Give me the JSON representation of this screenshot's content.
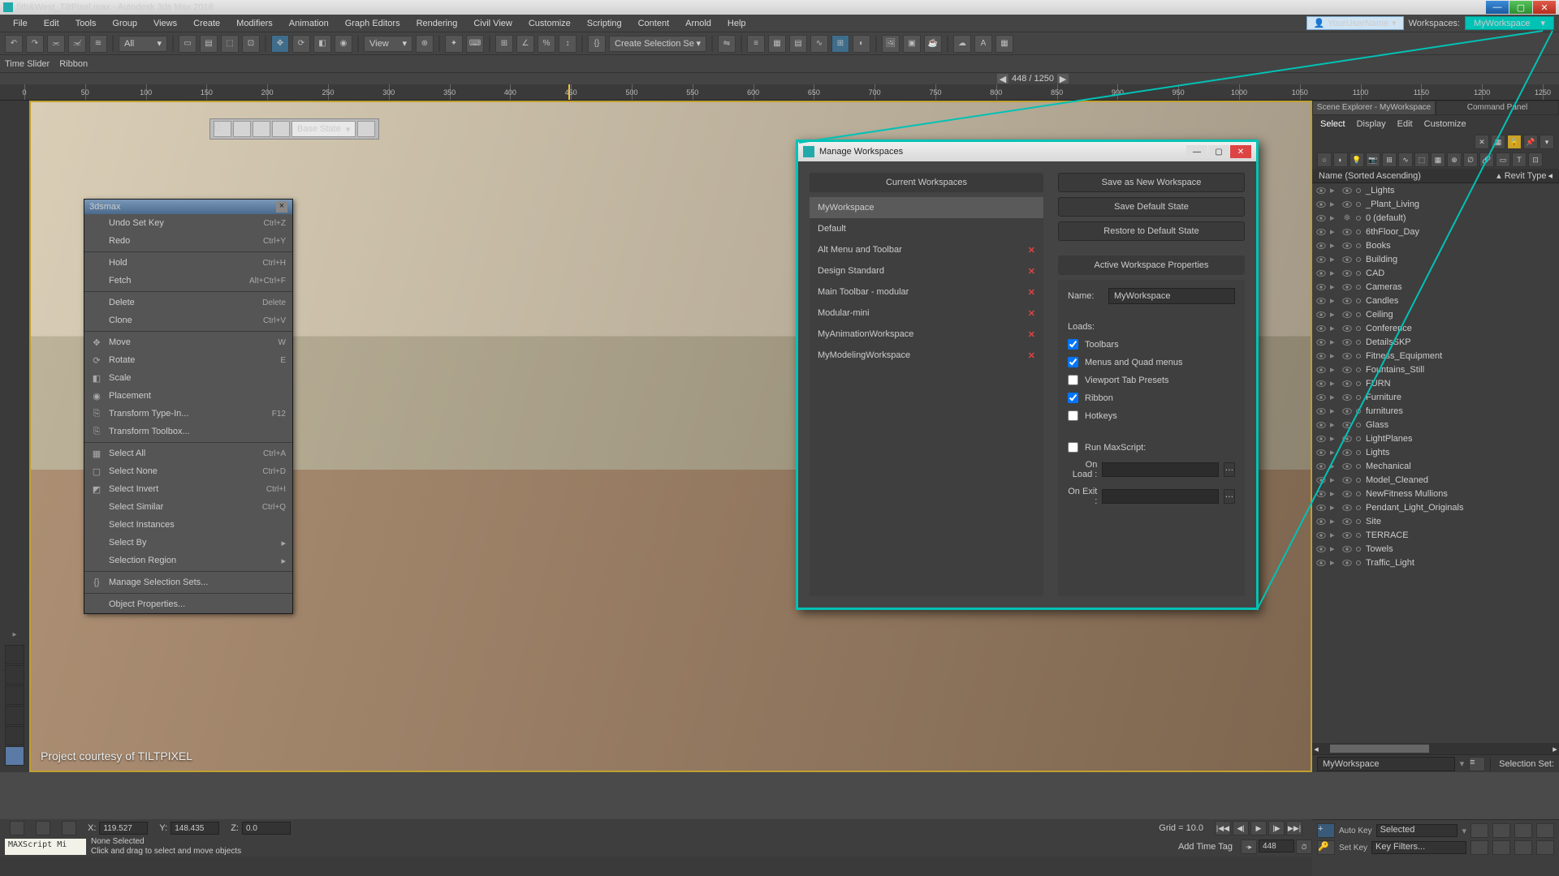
{
  "title": "5th&West_TiltPixel.max - Autodesk 3ds Max 2018",
  "menus": [
    "File",
    "Edit",
    "Tools",
    "Group",
    "Views",
    "Create",
    "Modifiers",
    "Animation",
    "Graph Editors",
    "Rendering",
    "Civil View",
    "Customize",
    "Scripting",
    "Content",
    "Arnold",
    "Help"
  ],
  "user_label": "YourUserName",
  "ws_label": "Workspaces:",
  "ws_current": "MyWorkspace",
  "toolbar_all": "All",
  "toolbar_view": "View",
  "toolbar_selset": "Create Selection Se",
  "ribbon_tabs": [
    "Time Slider",
    "Ribbon"
  ],
  "frame_display": "448 / 1250",
  "ruler_ticks": [
    0,
    50,
    100,
    150,
    200,
    250,
    300,
    350,
    400,
    450,
    500,
    550,
    600,
    650,
    700,
    750,
    800,
    850,
    900,
    950,
    1000,
    1050,
    1100,
    1150,
    1200,
    1250
  ],
  "playhead_frame": 448,
  "vptoolbar_state": "Base State",
  "vp_caption": "Project courtesy of TILTPIXEL",
  "cmdpanel": {
    "tab1": "Scene Explorer - MyWorkspace",
    "tab2": "Command Panel"
  },
  "exfilter": [
    "Select",
    "Display",
    "Edit",
    "Customize"
  ],
  "excol_name": "Name (Sorted Ascending)",
  "excol_type": "Revit Type",
  "nodes": [
    {
      "name": "_Lights",
      "indent": 1
    },
    {
      "name": "_Plant_Living",
      "indent": 1
    },
    {
      "name": "0 (default)",
      "indent": 1,
      "special": true
    },
    {
      "name": "6thFloor_Day",
      "indent": 1
    },
    {
      "name": "Books",
      "indent": 1
    },
    {
      "name": "Building",
      "indent": 1
    },
    {
      "name": "CAD",
      "indent": 1
    },
    {
      "name": "Cameras",
      "indent": 1
    },
    {
      "name": "Candles",
      "indent": 1
    },
    {
      "name": "Ceiling",
      "indent": 1
    },
    {
      "name": "Conference",
      "indent": 1
    },
    {
      "name": "DetailsSKP",
      "indent": 1
    },
    {
      "name": "Fitness_Equipment",
      "indent": 1
    },
    {
      "name": "Fountains_Still",
      "indent": 1
    },
    {
      "name": "FURN",
      "indent": 1
    },
    {
      "name": "Furniture",
      "indent": 1
    },
    {
      "name": "furnitures",
      "indent": 1
    },
    {
      "name": "Glass",
      "indent": 1
    },
    {
      "name": "LightPlanes",
      "indent": 1
    },
    {
      "name": "Lights",
      "indent": 1
    },
    {
      "name": "Mechanical",
      "indent": 1
    },
    {
      "name": "Model_Cleaned",
      "indent": 1
    },
    {
      "name": "NewFitness Mullions",
      "indent": 1
    },
    {
      "name": "Pendant_Light_Originals",
      "indent": 1
    },
    {
      "name": "Site",
      "indent": 1
    },
    {
      "name": "TERRACE",
      "indent": 1
    },
    {
      "name": "Towels",
      "indent": 1
    },
    {
      "name": "Traffic_Light",
      "indent": 1
    }
  ],
  "ws_combo_bottom": "MyWorkspace",
  "selset_label": "Selection Set:",
  "coord": {
    "x_lbl": "X:",
    "x": "119.527",
    "y_lbl": "Y:",
    "y": "148.435",
    "z_lbl": "Z:",
    "z": "0.0",
    "grid_lbl": "Grid = 10.0",
    "addtag": "Add Time Tag",
    "frame": "448"
  },
  "status": {
    "ms": "MAXScript Mi",
    "l1": "None Selected",
    "l2": "Click and drag to select and move objects"
  },
  "key": {
    "autokey": "Auto Key",
    "setkey": "Set Key",
    "sel": "Selected",
    "filters": "Key Filters..."
  },
  "ctx": {
    "title": "3dsmax",
    "items": [
      {
        "label": "Undo Set Key",
        "sc": "Ctrl+Z",
        "disabled": true
      },
      {
        "label": "Redo",
        "sc": "Ctrl+Y",
        "disabled": true
      },
      {
        "sep": true
      },
      {
        "label": "Hold",
        "sc": "Ctrl+H"
      },
      {
        "label": "Fetch",
        "sc": "Alt+Ctrl+F",
        "disabled": true
      },
      {
        "sep": true
      },
      {
        "label": "Delete",
        "sc": "Delete"
      },
      {
        "label": "Clone",
        "sc": "Ctrl+V",
        "disabled": true
      },
      {
        "sep": true
      },
      {
        "label": "Move",
        "sc": "W",
        "icon": "✥"
      },
      {
        "label": "Rotate",
        "sc": "E",
        "icon": "⟳"
      },
      {
        "label": "Scale",
        "icon": "◧"
      },
      {
        "label": "Placement",
        "icon": "◉"
      },
      {
        "label": "Transform Type-In...",
        "sc": "F12",
        "icon": "⎘"
      },
      {
        "label": "Transform Toolbox...",
        "icon": "⎘"
      },
      {
        "sep": true
      },
      {
        "label": "Select All",
        "sc": "Ctrl+A",
        "icon": "▦"
      },
      {
        "label": "Select None",
        "sc": "Ctrl+D",
        "icon": "▢"
      },
      {
        "label": "Select Invert",
        "sc": "Ctrl+I",
        "icon": "◩"
      },
      {
        "label": "Select Similar",
        "sc": "Ctrl+Q",
        "disabled": true
      },
      {
        "label": "Select Instances",
        "disabled": true
      },
      {
        "label": "Select By",
        "sub": true
      },
      {
        "label": "Selection Region",
        "sub": true
      },
      {
        "sep": true
      },
      {
        "label": "Manage Selection Sets...",
        "icon": "{}"
      },
      {
        "sep": true
      },
      {
        "label": "Object Properties...",
        "disabled": true
      }
    ]
  },
  "mws": {
    "title": "Manage Workspaces",
    "hdr_current": "Current Workspaces",
    "list": [
      {
        "name": "MyWorkspace",
        "sel": true,
        "del": false
      },
      {
        "name": "Default",
        "del": false
      },
      {
        "name": "Alt Menu and Toolbar",
        "del": true
      },
      {
        "name": "Design Standard",
        "del": true
      },
      {
        "name": "Main Toolbar - modular",
        "del": true
      },
      {
        "name": "Modular-mini",
        "del": true
      },
      {
        "name": "MyAnimationWorkspace",
        "del": true
      },
      {
        "name": "MyModelingWorkspace",
        "del": true
      }
    ],
    "btn_save_new": "Save as New Workspace",
    "btn_save_def": "Save Default State",
    "btn_restore": "Restore to Default State",
    "hdr_active": "Active Workspace Properties",
    "name_lbl": "Name:",
    "name_val": "MyWorkspace",
    "loads_lbl": "Loads:",
    "chk_toolbars": "Toolbars",
    "chk_menus": "Menus and Quad menus",
    "chk_vptabs": "Viewport Tab Presets",
    "chk_ribbon": "Ribbon",
    "chk_hotkeys": "Hotkeys",
    "run_ms": "Run MaxScript:",
    "onload": "On Load :",
    "onexit": "On Exit :"
  }
}
